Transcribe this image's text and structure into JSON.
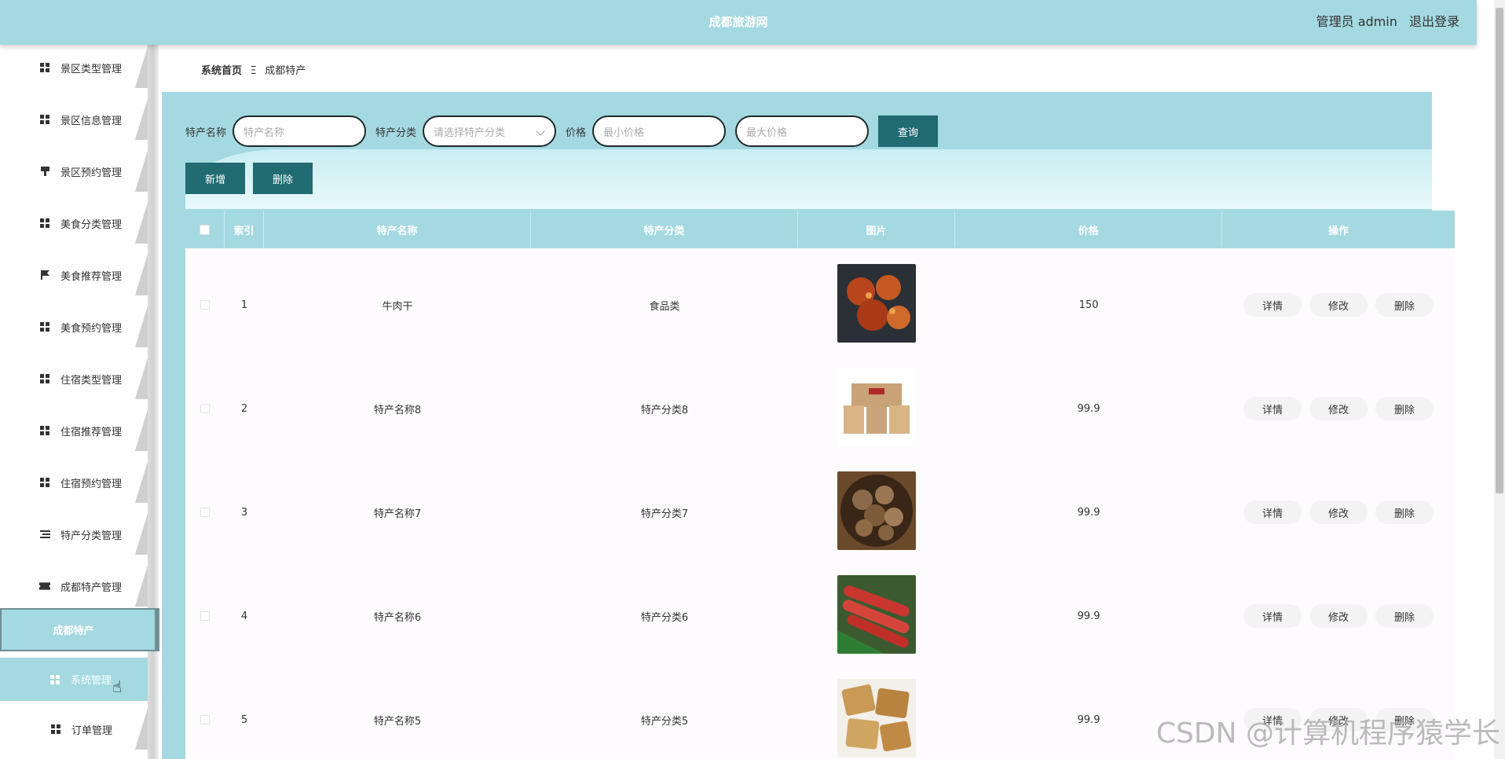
{
  "header": {
    "title": "成都旅游网",
    "user_role": "管理员 admin",
    "logout": "退出登录"
  },
  "sidebar": {
    "items": [
      {
        "label": "景区类型管理",
        "icon": "grid-icon"
      },
      {
        "label": "景区信息管理",
        "icon": "grid-icon"
      },
      {
        "label": "景区预约管理",
        "icon": "stamp-icon"
      },
      {
        "label": "美食分类管理",
        "icon": "grid-icon"
      },
      {
        "label": "美食推荐管理",
        "icon": "flag-icon"
      },
      {
        "label": "美食预约管理",
        "icon": "grid-icon"
      },
      {
        "label": "住宿类型管理",
        "icon": "grid-icon"
      },
      {
        "label": "住宿推荐管理",
        "icon": "grid-icon"
      },
      {
        "label": "住宿预约管理",
        "icon": "grid-icon"
      },
      {
        "label": "特产分类管理",
        "icon": "list-icon"
      },
      {
        "label": "成都特产管理",
        "icon": "ticket-icon"
      }
    ],
    "active_sub": "成都特产",
    "system": "系统管理",
    "orders": "订单管理"
  },
  "breadcrumb": {
    "home": "系统首页",
    "sep": "Ξ",
    "current": "成都特产"
  },
  "search": {
    "name_label": "特产名称",
    "name_placeholder": "特产名称",
    "category_label": "特产分类",
    "category_placeholder": "请选择特产分类",
    "price_label": "价格",
    "min_placeholder": "最小价格",
    "max_placeholder": "最大价格",
    "query": "查询"
  },
  "actions": {
    "add": "新增",
    "delete": "删除"
  },
  "table": {
    "columns": [
      "索引",
      "特产名称",
      "特产分类",
      "图片",
      "价格",
      "操作"
    ],
    "ops": {
      "detail": "详情",
      "edit": "修改",
      "delete": "删除"
    },
    "rows": [
      {
        "index": "1",
        "name": "牛肉干",
        "category": "食品类",
        "price": "150",
        "image": "roasted-meat"
      },
      {
        "index": "2",
        "name": "特产名称8",
        "category": "特产分类8",
        "price": "99.9",
        "image": "gift-boxes"
      },
      {
        "index": "3",
        "name": "特产名称7",
        "category": "特产分类7",
        "price": "99.9",
        "image": "mushrooms"
      },
      {
        "index": "4",
        "name": "特产名称6",
        "category": "特产分类6",
        "price": "99.9",
        "image": "sausages"
      },
      {
        "index": "5",
        "name": "特产名称5",
        "category": "特产分类5",
        "price": "99.9",
        "image": "sesame-candy"
      }
    ]
  },
  "watermark": "CSDN @计算机程序猿学长",
  "colors": {
    "accent": "#a4d9e1",
    "button": "#216b73"
  }
}
